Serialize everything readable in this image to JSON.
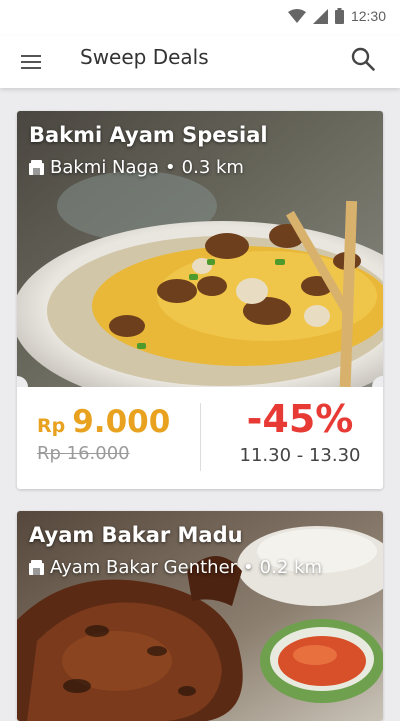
{
  "status": {
    "time": "12:30"
  },
  "app_bar": {
    "title": "Sweep Deals",
    "menu_icon": "menu-icon",
    "search_icon": "search-icon"
  },
  "deals": [
    {
      "title": "Bakmi Ayam Spesial",
      "shop": "Bakmi Naga",
      "distance": "0.3 km",
      "currency": "Rp",
      "price": "9.000",
      "old_price": "Rp 16.000",
      "discount": "-45%",
      "time_range": "11.30 - 13.30"
    },
    {
      "title": "Ayam Bakar Madu",
      "shop": "Ayam Bakar Genther",
      "distance": "0.2 km"
    }
  ],
  "separator": "•",
  "colors": {
    "price": "#e8a21f",
    "discount": "#e83a35",
    "old_price": "#9b9b9b"
  }
}
